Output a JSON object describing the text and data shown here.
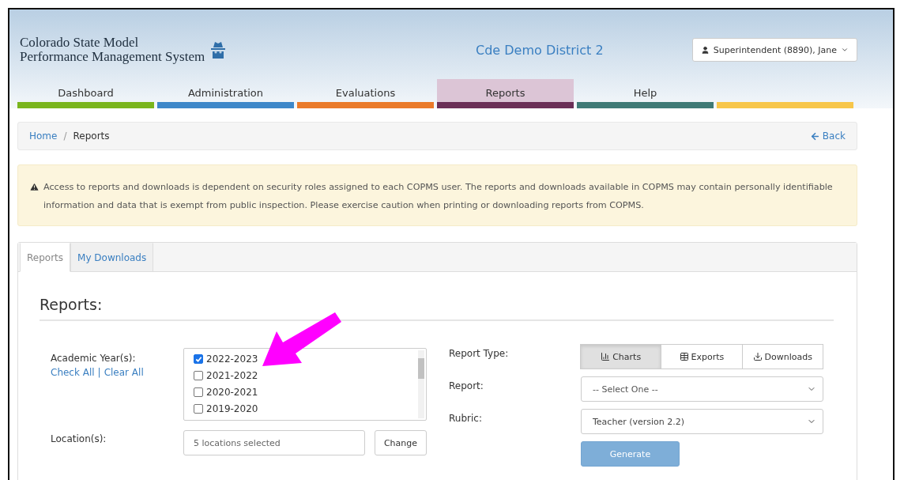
{
  "header": {
    "logo_lines": [
      "Colorado State Model",
      "Performance Management System"
    ],
    "district": "Cde Demo District 2",
    "user_menu": "Superintendent (8890), Jane"
  },
  "nav": [
    {
      "label": "Dashboard",
      "color": "#7ab51d",
      "selected": false
    },
    {
      "label": "Administration",
      "color": "#3d87c9",
      "selected": false
    },
    {
      "label": "Evaluations",
      "color": "#ea7a2a",
      "selected": false
    },
    {
      "label": "Reports",
      "color": "#6b2f57",
      "selected": true
    },
    {
      "label": "Help",
      "color": "#3f7a76",
      "selected": false
    },
    {
      "color": "#f7c64a",
      "selected": false
    }
  ],
  "breadcrumb": [
    "Home",
    "/",
    "Reports"
  ],
  "back": "Back",
  "alert": "Access to reports and downloads is dependent on security roles assigned to each COPMS user. The reports and downloads available in COPMS may contain personally identifiable information and data that is exempt from public inspection. Please exercise caution when printing or downloading reports from COPMS.",
  "tabs": [
    {
      "label": "Reports",
      "selected": true
    },
    {
      "label": "My Downloads",
      "selected": false
    }
  ],
  "heading": "Reports:",
  "years": {
    "label": "Academic Year(s):",
    "check_all": "Check All",
    "separator": "|",
    "clear_all": "Clear All",
    "items": [
      {
        "label": "2022-2023",
        "checked": true
      },
      {
        "label": "2021-2022",
        "checked": false
      },
      {
        "label": "2020-2021",
        "checked": false
      },
      {
        "label": "2019-2020",
        "checked": false
      }
    ]
  },
  "locations": {
    "label": "Location(s):",
    "value": "5 locations selected",
    "button": "Change"
  },
  "report_type": {
    "label": "Report Type:",
    "options": [
      {
        "label": "Charts",
        "kind": "chart",
        "selected": true
      },
      {
        "label": "Exports",
        "kind": "table",
        "selected": false
      },
      {
        "label": "Downloads",
        "kind": "download",
        "selected": false
      }
    ]
  },
  "report": {
    "label": "Report:",
    "value": "-- Select One --"
  },
  "rubric": {
    "label": "Rubric:",
    "value": "Teacher (version 2.2)"
  },
  "generate": "Generate"
}
